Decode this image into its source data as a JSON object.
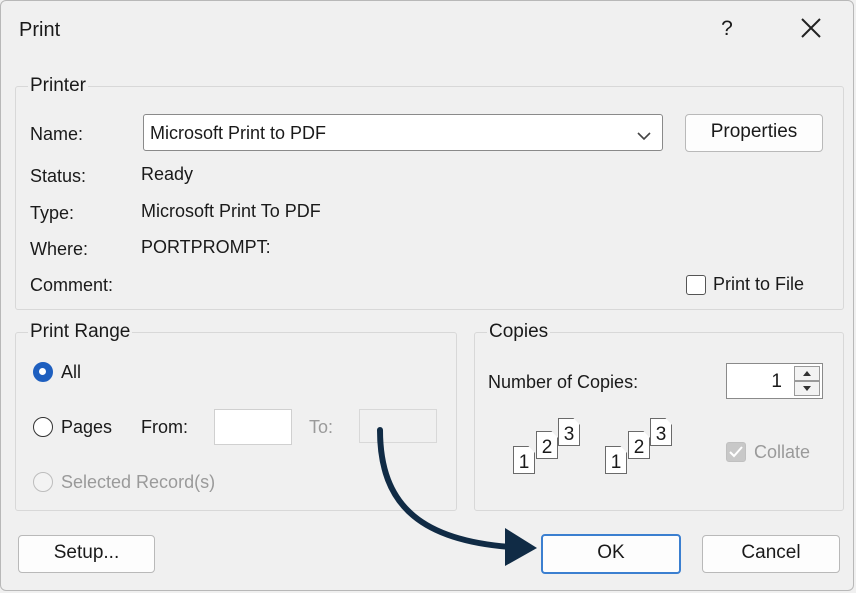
{
  "window": {
    "title": "Print",
    "help_glyph": "?",
    "close_glyph": "✕"
  },
  "printer": {
    "legend": "Printer",
    "name_label": "Name:",
    "name_value": "Microsoft Print to PDF",
    "properties_label": "Properties",
    "status_label": "Status:",
    "status_value": "Ready",
    "type_label": "Type:",
    "type_value": "Microsoft Print To PDF",
    "where_label": "Where:",
    "where_value": "PORTPROMPT:",
    "comment_label": "Comment:",
    "print_to_file_label": "Print to File",
    "print_to_file_checked": false
  },
  "print_range": {
    "legend": "Print Range",
    "all_label": "All",
    "pages_label": "Pages",
    "from_label": "From:",
    "from_value": "",
    "to_label": "To:",
    "to_value": "",
    "selected_records_label": "Selected Record(s)",
    "selected": "All"
  },
  "copies": {
    "legend": "Copies",
    "number_label": "Number of Copies:",
    "number_value": "1",
    "collate_label": "Collate",
    "collate_checked": true,
    "collate_enabled": false,
    "page_labels": [
      "1",
      "2",
      "3"
    ]
  },
  "footer": {
    "setup_label": "Setup...",
    "ok_label": "OK",
    "cancel_label": "Cancel"
  },
  "colors": {
    "accent": "#1e5fbf",
    "annotation_arrow": "#102b45"
  }
}
